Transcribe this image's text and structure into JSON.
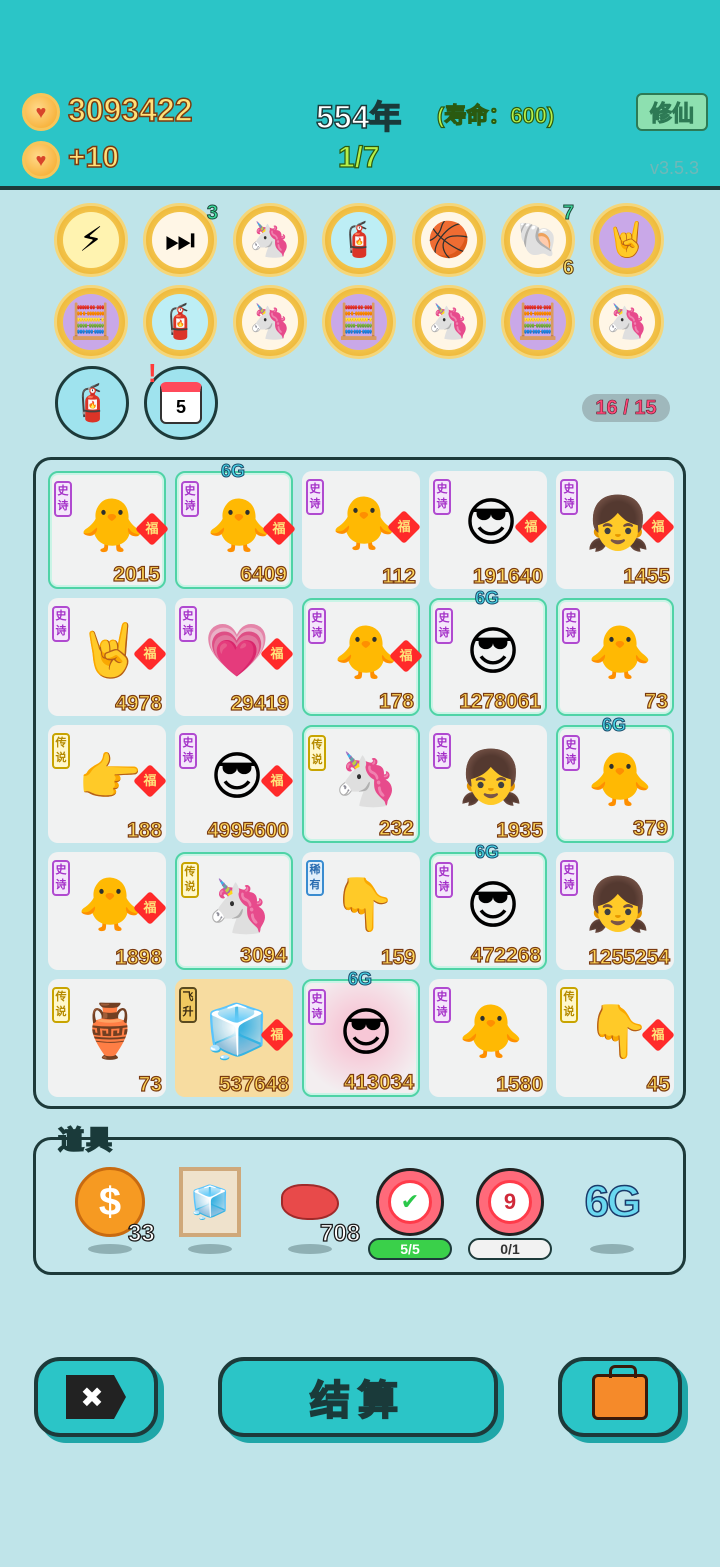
{
  "header": {
    "coins": "3093422",
    "income": "+10",
    "year": "554年",
    "lifespan": "(寿命：600)",
    "progress": "1/7",
    "cultivate_button": "修仙",
    "version": "v3.5.3"
  },
  "skills_row1": [
    {
      "icon": "lightning-icon",
      "glyph": "⚡"
    },
    {
      "icon": "skip-forward-icon",
      "glyph": "⏭",
      "badge": "3"
    },
    {
      "icon": "unicorn-icon",
      "glyph": "🦄"
    },
    {
      "icon": "air-pump-icon",
      "glyph": "🧯"
    },
    {
      "icon": "basketballs-icon",
      "glyph": "🏀"
    },
    {
      "icon": "shell-icon",
      "glyph": "🐚",
      "badge_top": "7",
      "badge_bottom": "6"
    },
    {
      "icon": "rock-hand-icon",
      "glyph": "🤘"
    }
  ],
  "skills_row2": [
    {
      "icon": "math-boy-icon",
      "glyph": "🧮"
    },
    {
      "icon": "air-pump-icon",
      "glyph": "🧯"
    },
    {
      "icon": "unicorn-icon",
      "glyph": "🦄"
    },
    {
      "icon": "math-boy-icon",
      "glyph": "🧮"
    },
    {
      "icon": "unicorn-icon",
      "glyph": "🦄"
    },
    {
      "icon": "math-boy-icon",
      "glyph": "🧮"
    },
    {
      "icon": "unicorn-icon",
      "glyph": "🦄"
    }
  ],
  "extra_tools": [
    {
      "icon": "air-pump-icon",
      "glyph": "🧯"
    },
    {
      "icon": "calendar-icon",
      "day": "5"
    }
  ],
  "slot_counter": "16 / 15",
  "board": [
    [
      {
        "tag": "史诗",
        "kind": "epic",
        "art": "chick-icon",
        "glyph": "🐥",
        "value": "2015",
        "fu": true,
        "glow": true
      },
      {
        "tag": "史诗",
        "kind": "epic",
        "art": "chick-icon",
        "glyph": "🐥",
        "value": "6409",
        "fu": true,
        "glow": true,
        "sixg": "6G"
      },
      {
        "tag": "史诗",
        "kind": "epic",
        "art": "chick-icon",
        "glyph": "🐥",
        "value": "112",
        "fu": true
      },
      {
        "tag": "史诗",
        "kind": "epic",
        "art": "cool-boy-icon",
        "glyph": "😎",
        "value": "191640",
        "fu": true
      },
      {
        "tag": "史诗",
        "kind": "epic",
        "art": "girl-icon",
        "glyph": "👧",
        "value": "1455",
        "fu": true
      }
    ],
    [
      {
        "tag": "史诗",
        "kind": "epic",
        "art": "rock-hand-icon",
        "glyph": "🤘",
        "value": "4978",
        "fu": true
      },
      {
        "tag": "史诗",
        "kind": "epic",
        "art": "heart-girl-icon",
        "glyph": "💗",
        "value": "29419",
        "fu": true
      },
      {
        "tag": "史诗",
        "kind": "epic",
        "art": "chick-icon",
        "glyph": "🐥",
        "value": "178",
        "fu": true,
        "glow": true
      },
      {
        "tag": "史诗",
        "kind": "epic",
        "art": "cool-boy-icon",
        "glyph": "😎",
        "value": "1278061",
        "glow": true,
        "sixg": "6G"
      },
      {
        "tag": "史诗",
        "kind": "epic",
        "art": "chick-icon",
        "glyph": "🐥",
        "value": "73",
        "glow": true
      }
    ],
    [
      {
        "tag": "传说",
        "kind": "leg",
        "art": "pointing-hand-icon",
        "glyph": "👉",
        "value": "188",
        "fu": true
      },
      {
        "tag": "史诗",
        "kind": "epic",
        "art": "cool-boy-icon",
        "glyph": "😎",
        "value": "4995600",
        "fu": true
      },
      {
        "tag": "传说",
        "kind": "leg",
        "art": "unicorn-icon",
        "glyph": "🦄",
        "value": "232",
        "glow": true
      },
      {
        "tag": "史诗",
        "kind": "epic",
        "art": "girl-icon",
        "glyph": "👧",
        "value": "1935"
      },
      {
        "tag": "史诗",
        "kind": "epic",
        "art": "chick-icon",
        "glyph": "🐥",
        "value": "379",
        "glow": true,
        "sixg": "6G"
      }
    ],
    [
      {
        "tag": "史诗",
        "kind": "epic",
        "art": "chick-icon",
        "glyph": "🐥",
        "value": "1898",
        "fu": true
      },
      {
        "tag": "传说",
        "kind": "leg",
        "art": "unicorn-icon",
        "glyph": "🦄",
        "value": "3094",
        "glow": true
      },
      {
        "tag": "稀有",
        "kind": "rare",
        "art": "pointing-hand-icon",
        "glyph": "👇",
        "value": "159"
      },
      {
        "tag": "史诗",
        "kind": "epic",
        "art": "cool-boy-icon",
        "glyph": "😎",
        "value": "472268",
        "glow": true,
        "sixg": "6G"
      },
      {
        "tag": "史诗",
        "kind": "epic",
        "art": "girl-icon",
        "glyph": "👧",
        "value": "1255254"
      }
    ],
    [
      {
        "tag": "传说",
        "kind": "leg",
        "art": "jade-vase-icon",
        "glyph": "🏺",
        "value": "73"
      },
      {
        "tag": "飞升",
        "kind": "fly",
        "art": "fridge-icon",
        "glyph": "🧊",
        "value": "537648",
        "fu": true,
        "gold": true
      },
      {
        "tag": "史诗",
        "kind": "epic",
        "art": "cool-boy-icon",
        "glyph": "😎",
        "value": "413034",
        "glow": true,
        "sixg": "6G",
        "pink": true
      },
      {
        "tag": "史诗",
        "kind": "epic",
        "art": "chick-icon",
        "glyph": "🐥",
        "value": "1580"
      },
      {
        "tag": "传说",
        "kind": "leg",
        "art": "pointing-hand-icon",
        "glyph": "👇",
        "value": "45",
        "fu": true
      }
    ]
  ],
  "fu_label": "福",
  "props_label": "道具",
  "props": {
    "coin_count": "33",
    "liver_count": "708",
    "check_progress": "5/5",
    "target_number": "9",
    "target_progress": "0/1",
    "sixg_label": "6G"
  },
  "buttons": {
    "close_glyph": "✖",
    "settle": "结算"
  }
}
